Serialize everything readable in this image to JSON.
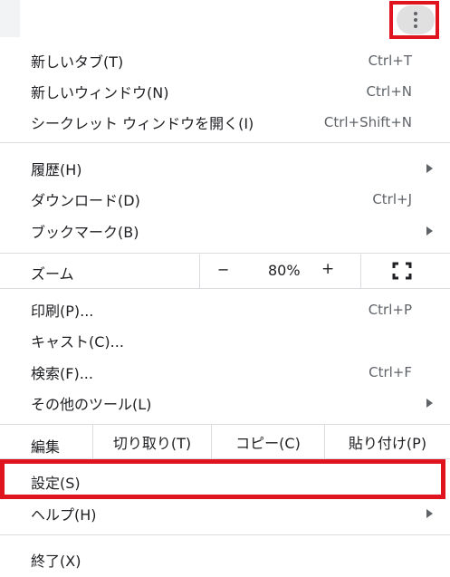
{
  "menu": {
    "new_tab": {
      "label": "新しいタブ(T)",
      "shortcut": "Ctrl+T"
    },
    "new_window": {
      "label": "新しいウィンドウ(N)",
      "shortcut": "Ctrl+N"
    },
    "incognito": {
      "label": "シークレット ウィンドウを開く(I)",
      "shortcut": "Ctrl+Shift+N"
    },
    "history": {
      "label": "履歴(H)"
    },
    "downloads": {
      "label": "ダウンロード(D)",
      "shortcut": "Ctrl+J"
    },
    "bookmarks": {
      "label": "ブックマーク(B)"
    },
    "zoom": {
      "label": "ズーム",
      "minus": "−",
      "value": "80%",
      "plus": "+"
    },
    "print": {
      "label": "印刷(P)...",
      "shortcut": "Ctrl+P"
    },
    "cast": {
      "label": "キャスト(C)..."
    },
    "find": {
      "label": "検索(F)...",
      "shortcut": "Ctrl+F"
    },
    "more_tools": {
      "label": "その他のツール(L)"
    },
    "edit": {
      "label": "編集",
      "cut": "切り取り(T)",
      "copy": "コピー(C)",
      "paste": "貼り付け(P)"
    },
    "settings": {
      "label": "設定(S)"
    },
    "help": {
      "label": "ヘルプ(H)"
    },
    "exit": {
      "label": "終了(X)"
    }
  },
  "colors": {
    "highlight": "#e0141e",
    "separator": "#dadce0"
  },
  "icons": {
    "menu": "kebab-menu-icon",
    "fullscreen": "fullscreen-icon",
    "submenu": "chevron-right-icon"
  }
}
